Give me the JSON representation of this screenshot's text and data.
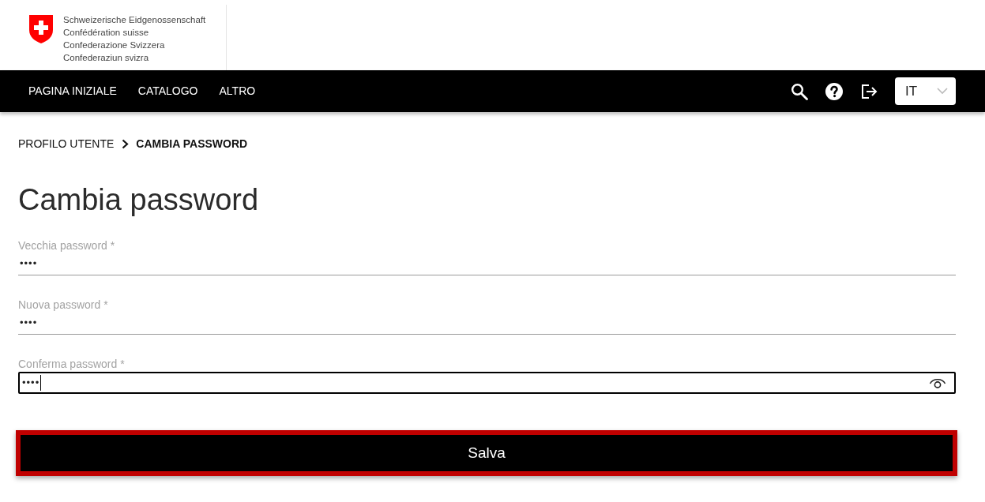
{
  "header": {
    "logo_lines": [
      "Schweizerische Eidgenossenschaft",
      "Confédération suisse",
      "Confederazione Svizzera",
      "Confederaziun svizra"
    ]
  },
  "navbar": {
    "items": [
      "PAGINA INIZIALE",
      "CATALOGO",
      "ALTRO"
    ],
    "language": {
      "value": "IT"
    }
  },
  "breadcrumb": [
    {
      "label": "PROFILO UTENTE",
      "current": false
    },
    {
      "label": "CAMBIA PASSWORD",
      "current": true
    }
  ],
  "page_title": "Cambia password",
  "fields": [
    {
      "label": "Vecchia password *",
      "value": "••••",
      "focused": false
    },
    {
      "label": "Nuova password *",
      "value": "••••",
      "focused": false
    },
    {
      "label": "Conferma password *",
      "value": "••••",
      "focused": true
    }
  ],
  "buttons": [
    {
      "label": "Salva"
    }
  ]
}
